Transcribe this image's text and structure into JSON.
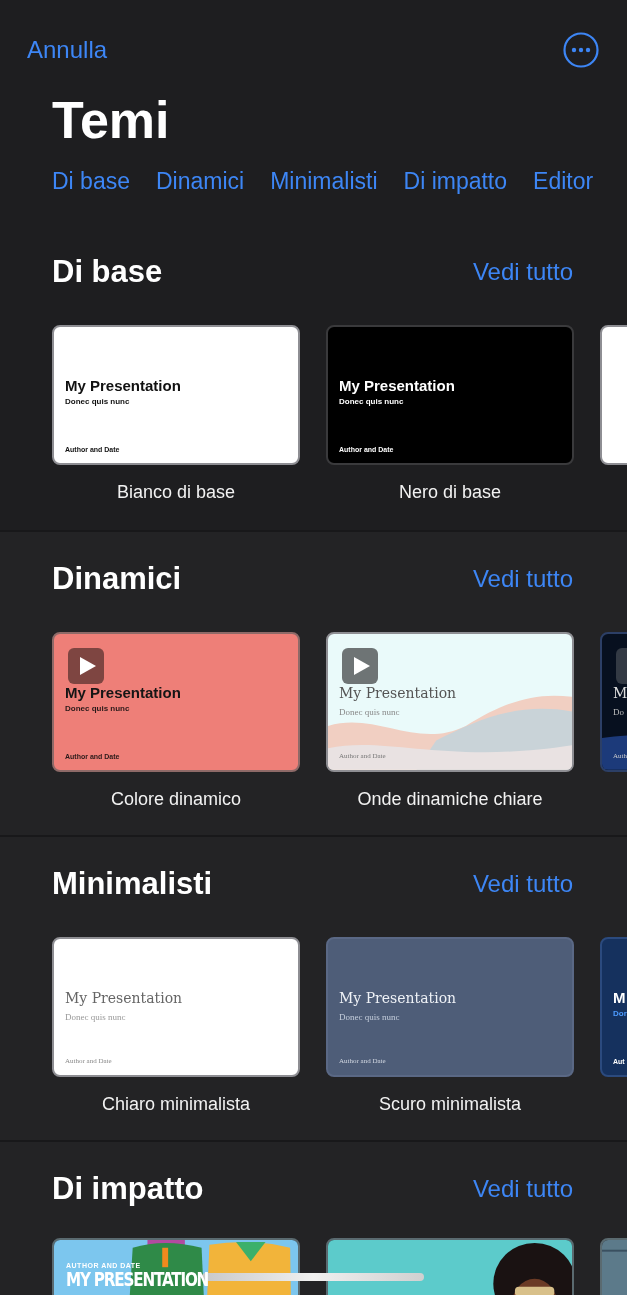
{
  "nav": {
    "cancel": "Annulla"
  },
  "title": "Temi",
  "categories": [
    "Di base",
    "Dinamici",
    "Minimalisti",
    "Di impatto",
    "Editor"
  ],
  "sections": [
    {
      "title": "Di base",
      "see_all": "Vedi tutto",
      "themes": [
        {
          "kind": "white",
          "video": false,
          "name": "Bianco di base",
          "title": "My Presentation",
          "subtitle": "Donec quis nunc",
          "author": "Author and Date"
        },
        {
          "kind": "black",
          "video": false,
          "name": "Nero di base",
          "title": "My Presentation",
          "subtitle": "Donec quis nunc",
          "author": "Author and Date"
        },
        {
          "kind": "blank"
        }
      ]
    },
    {
      "title": "Dinamici",
      "see_all": "Vedi tutto",
      "themes": [
        {
          "kind": "coral",
          "video": true,
          "name": "Colore dinamico",
          "title": "My Presentation",
          "subtitle": "Donec quis nunc",
          "author": "Author and Date"
        },
        {
          "kind": "waves",
          "video": true,
          "name": "Onde dinamiche chiare",
          "title": "My Presentation",
          "subtitle": "Donec quis nunc",
          "author": "Author and Date"
        },
        {
          "kind": "nightwaves",
          "video": true,
          "title": "M",
          "subtitle": "Do",
          "author": "Auth"
        }
      ]
    },
    {
      "title": "Minimalisti",
      "see_all": "Vedi tutto",
      "themes": [
        {
          "kind": "light",
          "video": false,
          "name": "Chiaro minimalista",
          "title": "My Presentation",
          "subtitle": "Donec quis nunc",
          "author": "Author and Date"
        },
        {
          "kind": "slate",
          "video": false,
          "name": "Scuro minimalista",
          "title": "My Presentation",
          "subtitle": "Donec quis nunc",
          "author": "Author and Date"
        },
        {
          "kind": "navy",
          "video": false,
          "title": "M",
          "subtitle": "Dor",
          "author": "Aut"
        }
      ]
    },
    {
      "title": "Di impatto",
      "see_all": "Vedi tutto",
      "themes": [
        {
          "kind": "duo",
          "title": "MY PRESENTATION",
          "author": "AUTHOR AND DATE"
        },
        {
          "kind": "portrait"
        },
        {
          "kind": "plain"
        }
      ]
    }
  ]
}
